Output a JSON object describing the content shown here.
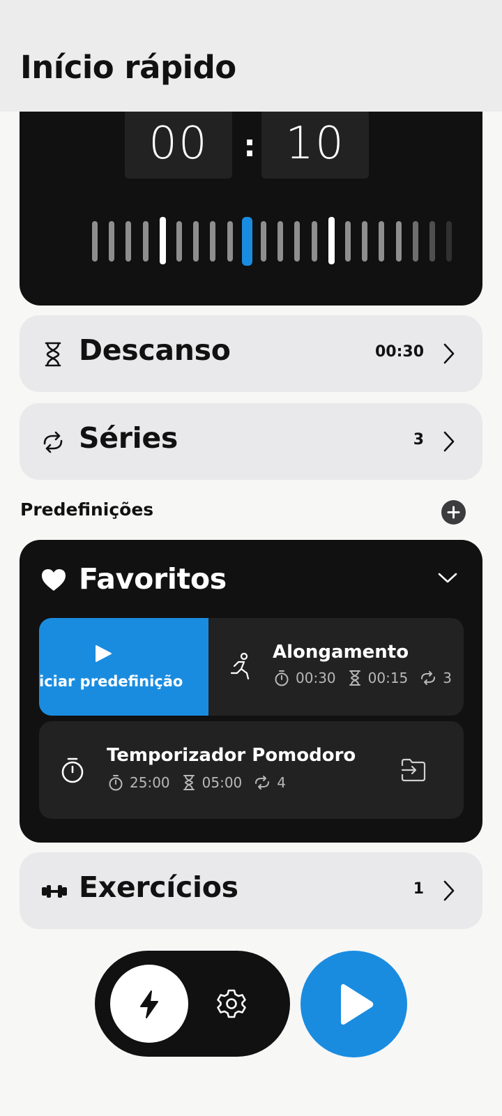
{
  "header": {
    "title": "Início rápido"
  },
  "timer": {
    "minutes": "00",
    "separator": ":",
    "seconds": "10"
  },
  "rest": {
    "title": "Descanso",
    "value": "00:30",
    "icon": "hourglass-icon"
  },
  "sets": {
    "title": "Séries",
    "value": "3",
    "icon": "repeat-icon"
  },
  "presets": {
    "label": "Predefinições",
    "favorites": {
      "title": "Favoritos",
      "items": [
        {
          "title": "Alongamento",
          "work": "00:30",
          "rest": "00:15",
          "sets": "3",
          "swipe_action": "Iniciar predefinição",
          "swipe_action_visible": "iciar predefinição"
        },
        {
          "title": "Temporizador Pomodoro",
          "work": "25:00",
          "rest": "05:00",
          "sets": "4"
        }
      ]
    }
  },
  "exercises": {
    "title": "Exercícios",
    "value": "1",
    "icon": "dumbbell-icon"
  },
  "colors": {
    "accent": "#1a8ce0",
    "dark": "#111111",
    "card": "#e9e9eb"
  }
}
